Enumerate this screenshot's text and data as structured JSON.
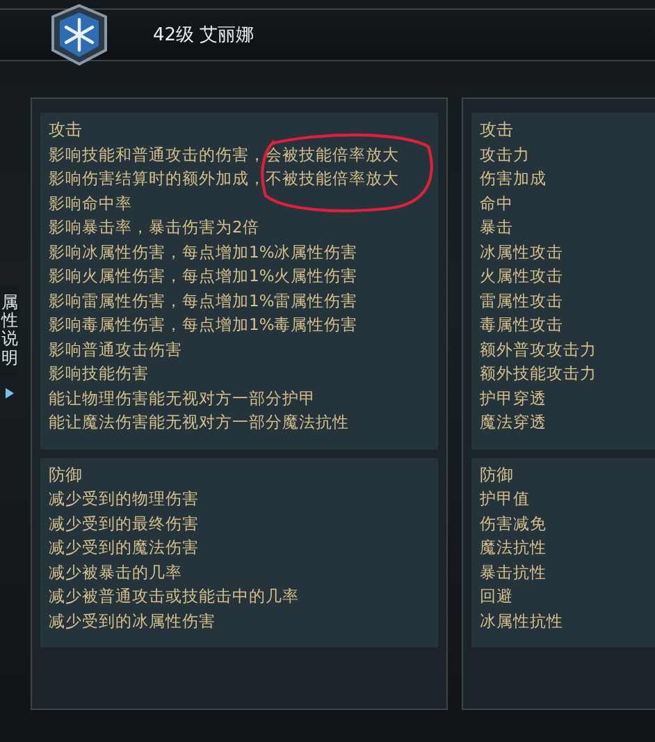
{
  "header": {
    "title": "42级 艾丽娜"
  },
  "side_tab": {
    "label": "属性说明"
  },
  "columns": [
    {
      "sections": [
        {
          "title": "攻击",
          "lines": [
            "影响技能和普通攻击的伤害，会被技能倍率放大",
            "影响伤害结算时的额外加成，不被技能倍率放大",
            "影响命中率",
            "影响暴击率，暴击伤害为2倍",
            "影响冰属性伤害，每点增加1%冰属性伤害",
            "影响火属性伤害，每点增加1%火属性伤害",
            "影响雷属性伤害，每点增加1%雷属性伤害",
            "影响毒属性伤害，每点增加1%毒属性伤害",
            "影响普通攻击伤害",
            "影响技能伤害",
            "能让物理伤害能无视对方一部分护甲",
            "能让魔法伤害能无视对方一部分魔法抗性"
          ]
        },
        {
          "title": "防御",
          "lines": [
            "减少受到的物理伤害",
            "减少受到的最终伤害",
            "减少受到的魔法伤害",
            "减少被暴击的几率",
            "减少被普通攻击或技能击中的几率",
            "减少受到的冰属性伤害"
          ]
        }
      ]
    },
    {
      "sections": [
        {
          "title": "攻击",
          "lines": [
            "攻击力",
            "伤害加成",
            "命中",
            "暴击",
            "冰属性攻击",
            "火属性攻击",
            "雷属性攻击",
            "毒属性攻击",
            "额外普攻攻击力",
            "额外技能攻击力",
            "护甲穿透",
            "魔法穿透"
          ]
        },
        {
          "title": "防御",
          "lines": [
            "护甲值",
            "伤害减免",
            "魔法抗性",
            "暴击抗性",
            "回避",
            "冰属性抗性"
          ]
        }
      ]
    }
  ]
}
